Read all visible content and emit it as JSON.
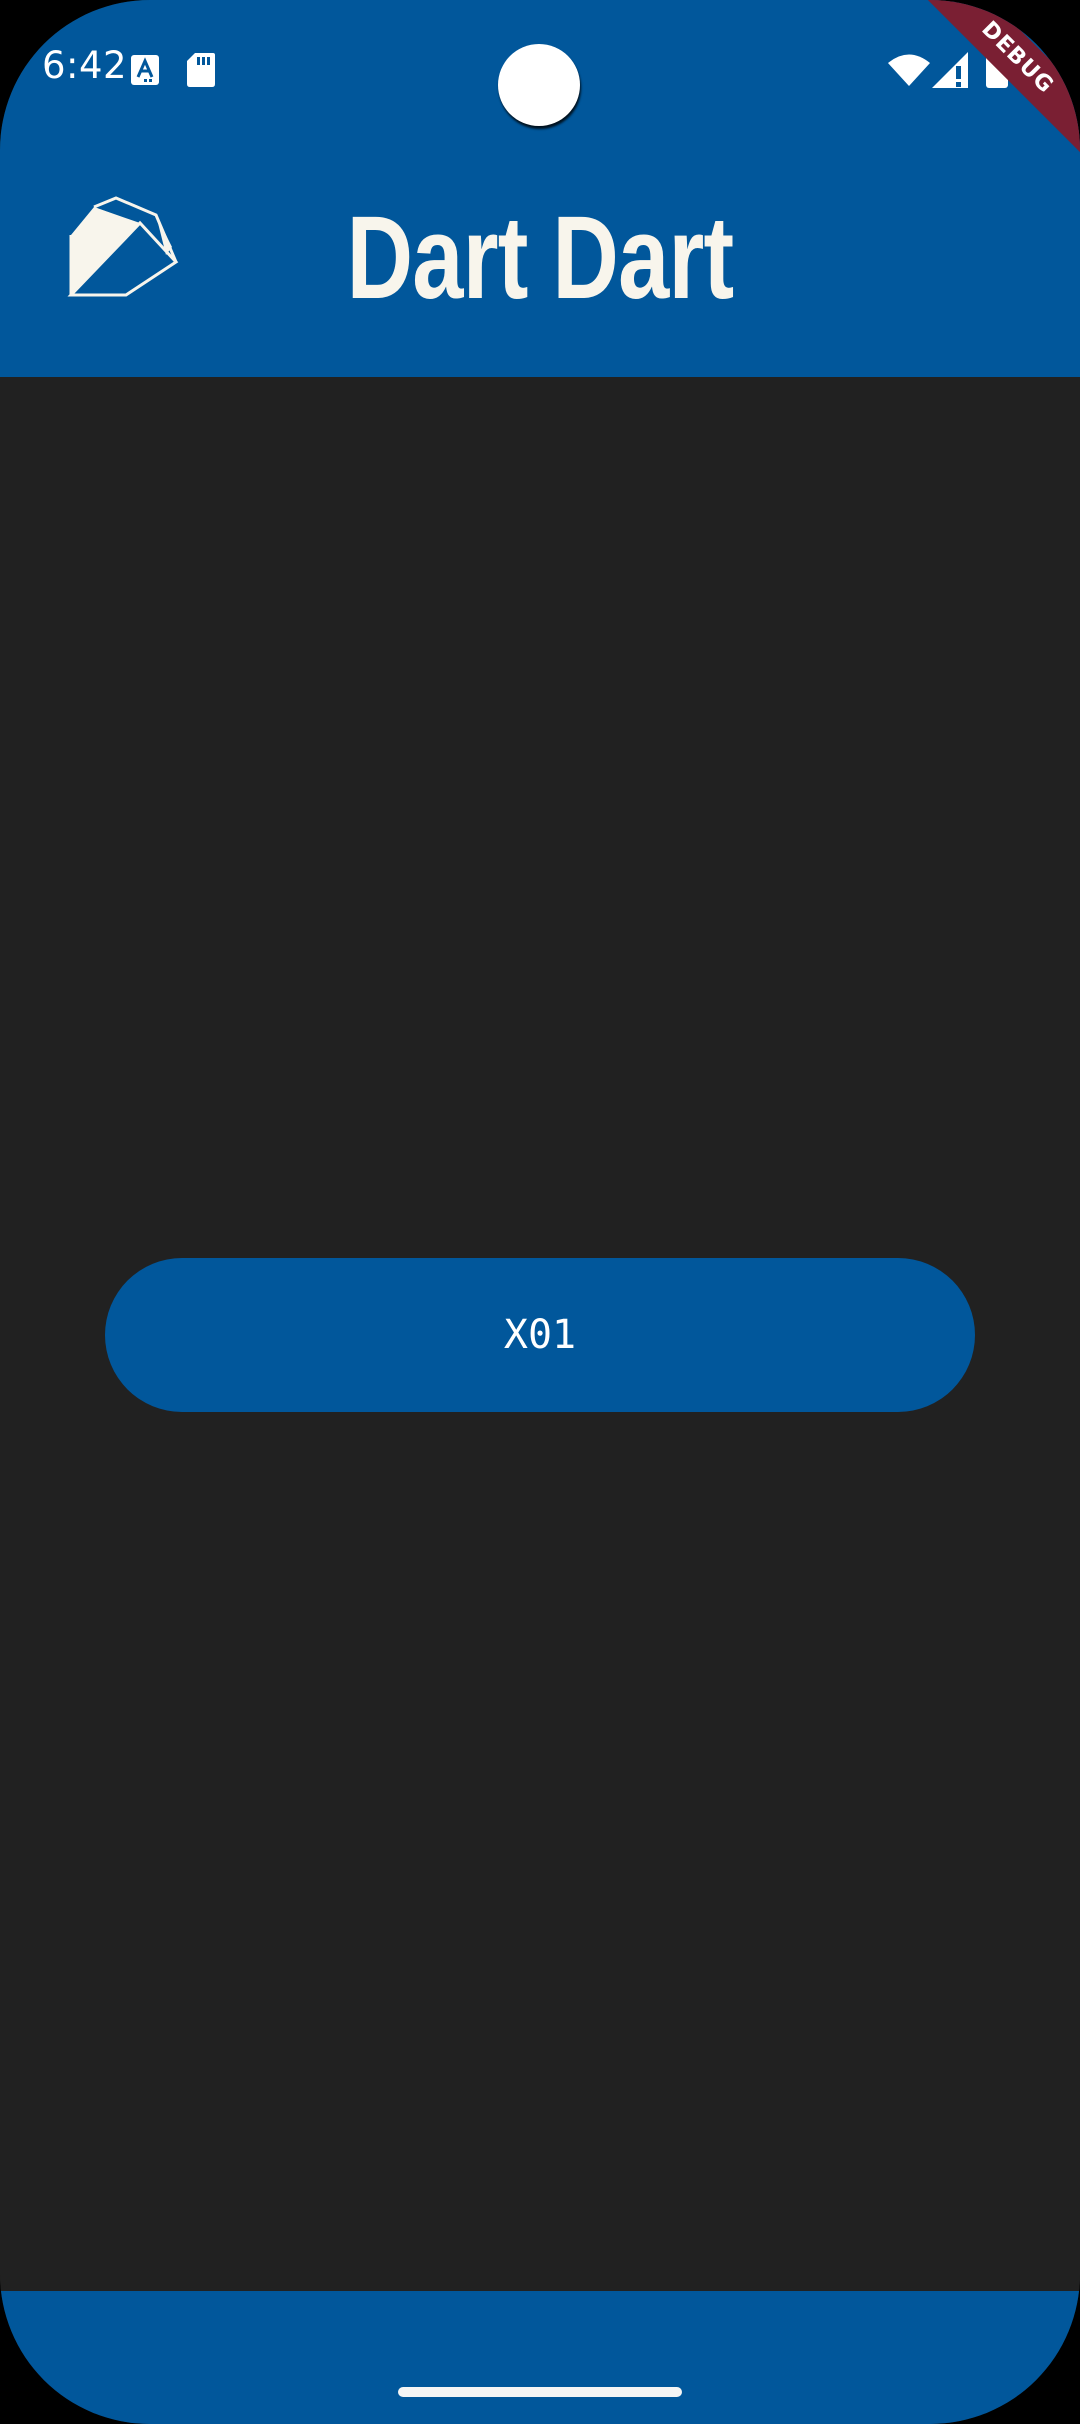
{
  "status_bar": {
    "time": "6:42",
    "icons_left": [
      "accessibility-a-icon",
      "sd-card-icon"
    ],
    "icons_right": [
      "wifi-icon",
      "cell-signal-icon",
      "battery-icon"
    ]
  },
  "debug_banner": "DEBUG",
  "app_bar": {
    "logo_icon": "dart-logo-icon",
    "title": "Dart Dart"
  },
  "main": {
    "button_label": "X01"
  },
  "colors": {
    "primary": "#01579b",
    "background": "#212121",
    "title_text": "#f8f5ec",
    "debug_ribbon": "#7a1f33"
  }
}
